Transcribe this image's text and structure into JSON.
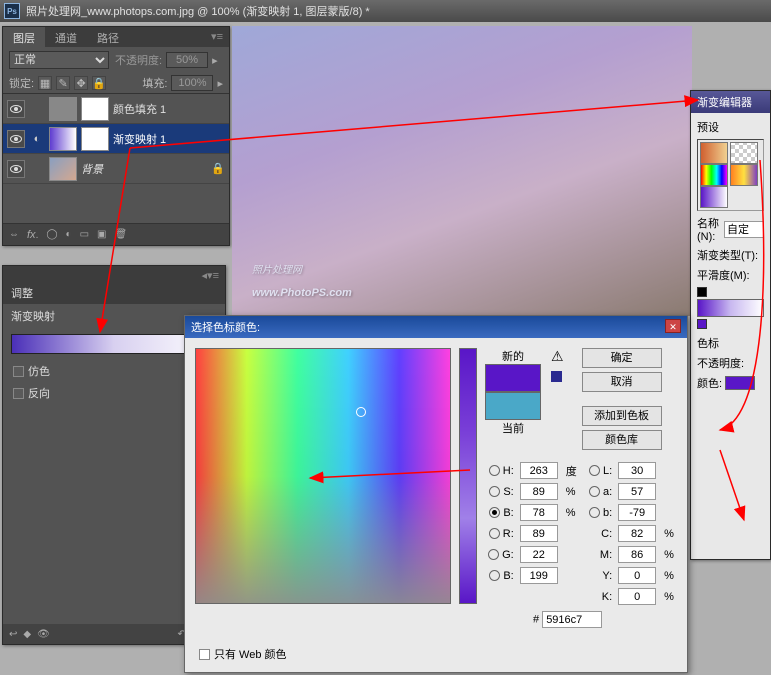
{
  "titlebar": {
    "text": "照片处理网_www.photops.com.jpg @ 100% (渐变映射 1, 图层蒙版/8) *"
  },
  "layers_panel": {
    "tabs": [
      "图层",
      "通道",
      "路径"
    ],
    "blend_mode": "正常",
    "opacity_label": "不透明度:",
    "opacity_value": "50%",
    "lock_label": "锁定:",
    "fill_label": "填充:",
    "fill_value": "100%",
    "layers": [
      {
        "name": "颜色填充 1",
        "selected": false
      },
      {
        "name": "渐变映射 1",
        "selected": true
      },
      {
        "name": "背景",
        "selected": false
      }
    ]
  },
  "adjust_panel": {
    "title": "调整",
    "subtitle": "渐变映射",
    "dither": "仿色",
    "reverse": "反向"
  },
  "canvas": {
    "watermark_small": "照片处理网",
    "watermark_big": "www.PhotoPS.com"
  },
  "grad_editor": {
    "title": "渐变编辑器",
    "presets_label": "预设",
    "name_label": "名称(N):",
    "name_value": "自定",
    "type_label": "渐变类型(T):",
    "smooth_label": "平滑度(M):",
    "stops_label": "色标",
    "stop_opacity_label": "不透明度:",
    "stop_color_label": "颜色:"
  },
  "color_picker": {
    "title": "选择色标颜色:",
    "new_label": "新的",
    "current_label": "当前",
    "btn_ok": "确定",
    "btn_cancel": "取消",
    "btn_add": "添加到色板",
    "btn_lib": "颜色库",
    "h_label": "H:",
    "h_val": "263",
    "h_unit": "度",
    "s_label": "S:",
    "s_val": "89",
    "s_unit": "%",
    "b_label": "B:",
    "b_val": "78",
    "b_unit": "%",
    "l_label": "L:",
    "l_val": "30",
    "a_label": "a:",
    "a_val": "57",
    "bb_label": "b:",
    "bb_val": "-79",
    "r_label": "R:",
    "r_val": "89",
    "g_label": "G:",
    "g_val": "22",
    "bl_label": "B:",
    "bl_val": "199",
    "c_label": "C:",
    "c_val": "82",
    "c_unit": "%",
    "m_label": "M:",
    "m_val": "86",
    "m_unit": "%",
    "y_label": "Y:",
    "y_val": "0",
    "y_unit": "%",
    "k_label": "K:",
    "k_val": "0",
    "k_unit": "%",
    "hex_val": "5916c7",
    "web_only": "只有 Web 颜色"
  }
}
